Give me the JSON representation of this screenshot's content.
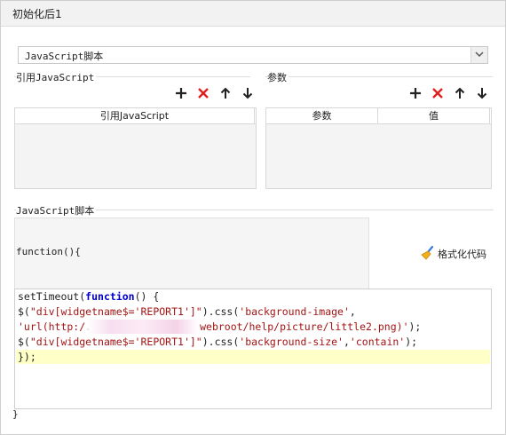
{
  "window": {
    "title": "初始化后1"
  },
  "script_type": {
    "selected": "JavaScript脚本"
  },
  "ref_js": {
    "label": "引用JavaScript",
    "column": "引用JavaScript"
  },
  "params": {
    "label": "参数",
    "columns": [
      "参数",
      "值"
    ]
  },
  "toolbar_icons": [
    "plus-icon",
    "delete-icon",
    "arrow-up-icon",
    "arrow-down-icon"
  ],
  "script_section": {
    "label": "JavaScript脚本",
    "function_open": "function(){",
    "format_button": "格式化代码",
    "function_close": "}"
  },
  "code": {
    "line1_a": "setTimeout(",
    "line1_kw": "function",
    "line1_b": "() {",
    "line2_a": "$(",
    "line2_str": "\"div[widgetname$='REPORT1']\"",
    "line2_b": ").css(",
    "line2_str2": "'background-image'",
    "line2_c": ",",
    "line3_str_a": "'url(http:/.",
    "line3_str_b": "webroot/help/picture/little2.png)'",
    "line3_c": ");",
    "line4_a": "$(",
    "line4_str": "\"div[widgetname$='REPORT1']\"",
    "line4_b": ").css(",
    "line4_str2": "'background-size'",
    "line4_c": ",",
    "line4_str3": "'contain'",
    "line4_d": ");",
    "line5": "});"
  },
  "colors": {
    "delete": "#e02020",
    "keyword": "#0000cc",
    "string": "#a31515",
    "highlight": "#ffffc8"
  }
}
